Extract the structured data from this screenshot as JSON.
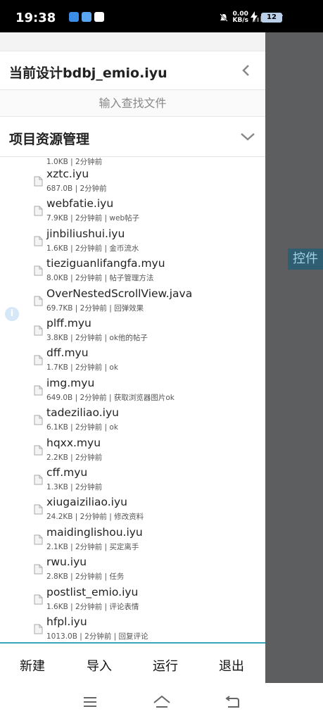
{
  "status_bar": {
    "time": "19:38",
    "net_speed_value": "0.00",
    "net_speed_unit": "KB/s",
    "battery": "12"
  },
  "drawer": {
    "title": "当前设计bdbj_emio.iyu",
    "search_placeholder": "输入查找文件",
    "section_title": "项目资源管理"
  },
  "files": {
    "partial_meta": "1.0KB | 2分钟前",
    "items": [
      {
        "name": "xztc.iyu",
        "meta": "687.0B | 2分钟前"
      },
      {
        "name": "webfatie.iyu",
        "meta": "7.9KB | 2分钟前 | web帖子"
      },
      {
        "name": "jinbiliushui.iyu",
        "meta": "1.6KB | 2分钟前 | 金币流水"
      },
      {
        "name": "tieziguanlifangfa.myu",
        "meta": "8.0KB | 2分钟前 | 帖子管理方法"
      },
      {
        "name": "OverNestedScrollView.java",
        "meta": "69.7KB | 2分钟前 | 回弹效果"
      },
      {
        "name": "plff.myu",
        "meta": "3.8KB | 2分钟前 | ok他的帖子"
      },
      {
        "name": "dff.myu",
        "meta": "1.7KB | 2分钟前 | ok"
      },
      {
        "name": "img.myu",
        "meta": "649.0B | 2分钟前 | 获取浏览器图片ok"
      },
      {
        "name": "tadeziliao.iyu",
        "meta": "6.1KB | 2分钟前 | ok"
      },
      {
        "name": "hqxx.myu",
        "meta": "2.2KB | 2分钟前"
      },
      {
        "name": "cff.myu",
        "meta": "1.3KB | 2分钟前"
      },
      {
        "name": "xiugaiziliao.iyu",
        "meta": "24.2KB | 2分钟前 | 修改资料"
      },
      {
        "name": "maidinglishou.iyu",
        "meta": "2.1KB | 2分钟前 | 买定离手"
      },
      {
        "name": "rwu.iyu",
        "meta": "2.8KB | 2分钟前 | 任务"
      },
      {
        "name": "postlist_emio.iyu",
        "meta": "1.6KB | 2分钟前 | 评论表情"
      },
      {
        "name": "hfpl.iyu",
        "meta": "1013.0B | 2分钟前 | 回复评论"
      }
    ]
  },
  "bottom_bar": {
    "new_label": "新建",
    "import_label": "导入",
    "run_label": "运行",
    "exit_label": "退出"
  },
  "side_panel": {
    "widget_label": "控件"
  },
  "info_icon_glyph": "i",
  "colors": {
    "accent": "#3aa6b9",
    "side_panel": "#5d5e60",
    "widget_tab_bg": "#2f5d72"
  }
}
